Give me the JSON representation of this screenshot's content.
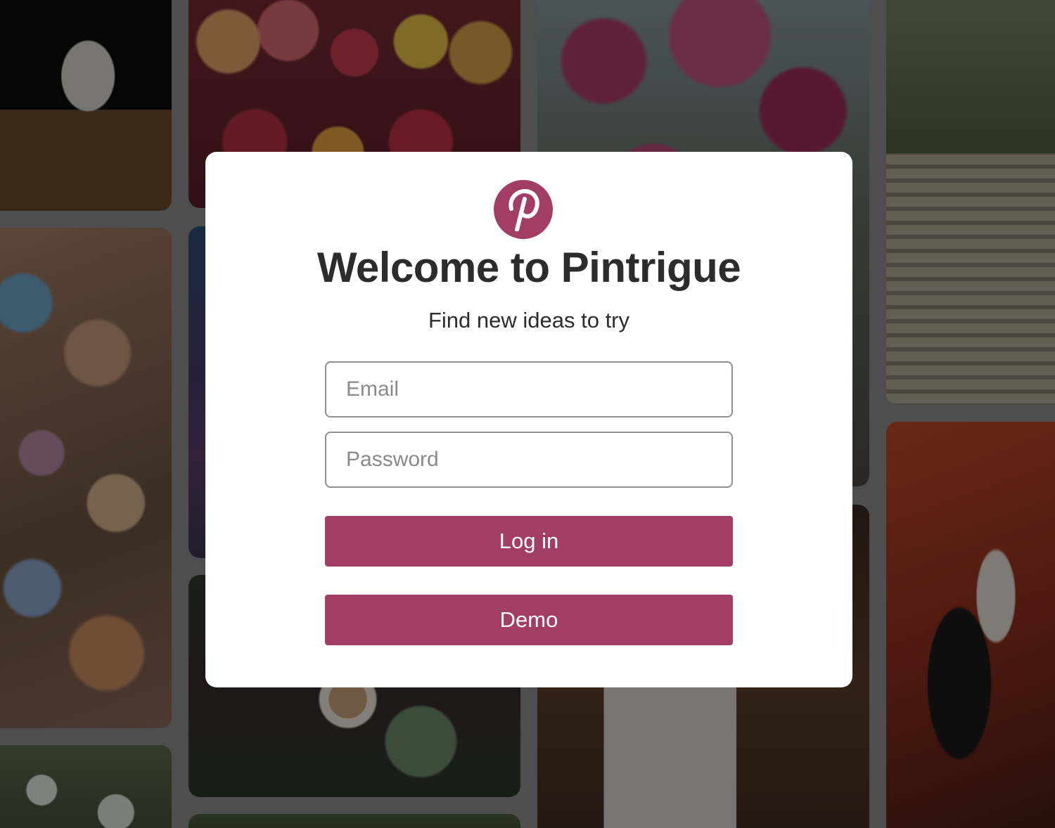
{
  "brand": {
    "logo_icon": "pinterest-p-icon",
    "accent_color": "#a23d66"
  },
  "login_modal": {
    "title": "Welcome to Pintrigue",
    "subtitle": "Find new ideas to try",
    "email": {
      "placeholder": "Email",
      "value": ""
    },
    "password": {
      "placeholder": "Password",
      "value": ""
    },
    "login_label": "Log in",
    "demo_label": "Demo"
  },
  "background": {
    "tiles": [
      "mug",
      "fruit",
      "blossom-tree",
      "boardwalk-stairs",
      "wind-bells",
      "yarn",
      "latte-plants",
      "curtain-branches",
      "graffiti",
      "white-flowers",
      "greenery"
    ]
  }
}
